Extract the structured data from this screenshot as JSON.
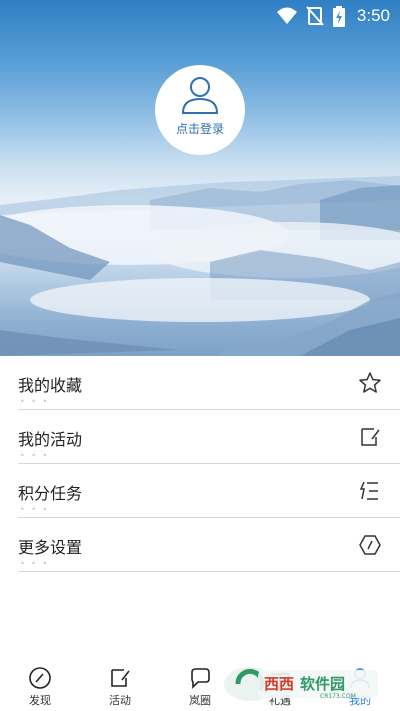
{
  "status_bar": {
    "time": "3:50",
    "icons": [
      "wifi-icon",
      "no-sim-icon",
      "battery-charging-icon"
    ]
  },
  "profile": {
    "avatar_icon": "person-icon",
    "login_label": "点击登录"
  },
  "menu": {
    "items": [
      {
        "label": "我的收藏",
        "icon": "star-icon"
      },
      {
        "label": "我的活动",
        "icon": "activity-edit-icon"
      },
      {
        "label": "积分任务",
        "icon": "task-list-icon"
      },
      {
        "label": "更多设置",
        "icon": "settings-hexagon-icon"
      }
    ],
    "separator_dots": "• • •"
  },
  "tabbar": {
    "tabs": [
      {
        "label": "发现",
        "icon": "compass-icon",
        "active": false
      },
      {
        "label": "活动",
        "icon": "activity-tab-icon",
        "active": false
      },
      {
        "label": "岚圈",
        "icon": "chat-circle-icon",
        "active": false
      },
      {
        "label": "礼遇",
        "icon": "gift-icon",
        "active": false
      },
      {
        "label": "我的",
        "icon": "profile-tab-icon",
        "active": true
      }
    ]
  },
  "watermark": {
    "text": "西西软件园",
    "sub": "CR173.COM"
  },
  "colors": {
    "accent": "#2f7fe0",
    "login_text": "#2f6fb4"
  }
}
